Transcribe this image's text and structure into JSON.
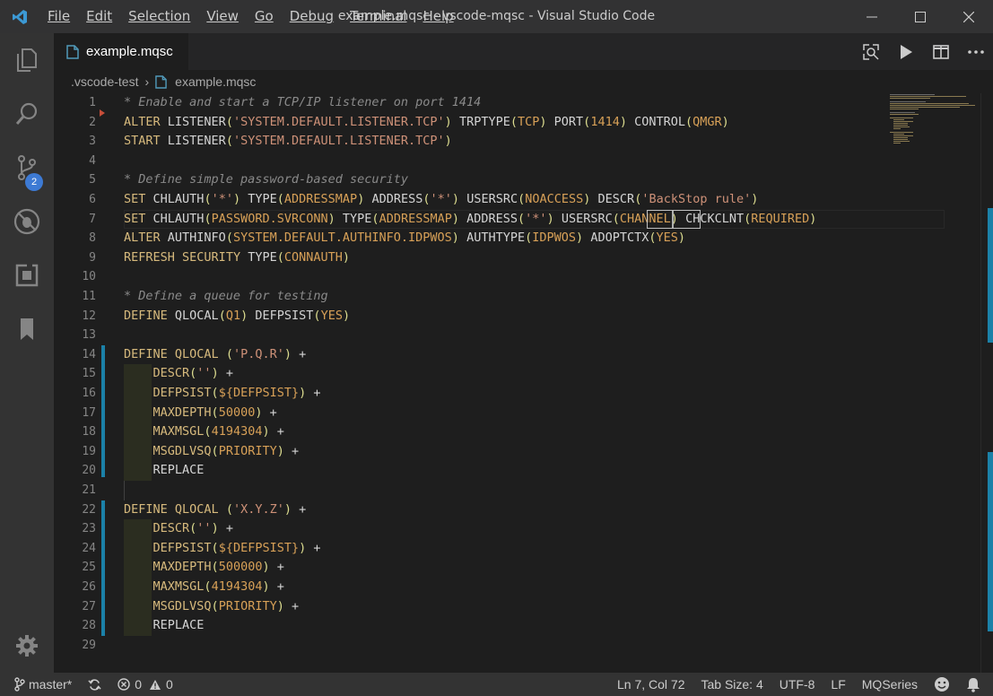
{
  "window": {
    "title": "example.mqsc - vscode-mqsc - Visual Studio Code"
  },
  "menu": {
    "items": [
      "File",
      "Edit",
      "Selection",
      "View",
      "Go",
      "Debug",
      "Terminal",
      "Help"
    ]
  },
  "activity_bar": {
    "items": [
      "explorer-icon",
      "search-icon",
      "source-control-icon",
      "debug-icon",
      "extensions-icon",
      "bookmarks-icon"
    ],
    "source_control_badge": "2",
    "settings_icon": "gear-icon"
  },
  "tab": {
    "label": "example.mqsc"
  },
  "breadcrumb": {
    "folder": ".vscode-test",
    "file": "example.mqsc"
  },
  "editor": {
    "line_numbers": [
      "1",
      "2",
      "3",
      "4",
      "5",
      "6",
      "7",
      "8",
      "9",
      "10",
      "11",
      "12",
      "13",
      "14",
      "15",
      "16",
      "17",
      "18",
      "19",
      "20",
      "21",
      "22",
      "23",
      "24",
      "25",
      "26",
      "27",
      "28",
      "29"
    ],
    "lines": [
      "* Enable and start a TCP/IP listener on port 1414",
      "ALTER LISTENER('SYSTEM.DEFAULT.LISTENER.TCP') TRPTYPE(TCP) PORT(1414) CONTROL(QMGR)",
      "START LISTENER('SYSTEM.DEFAULT.LISTENER.TCP')",
      "",
      "* Define simple password-based security",
      "SET CHLAUTH('*') TYPE(ADDRESSMAP) ADDRESS('*') USERSRC(NOACCESS) DESCR('BackStop rule')",
      "SET CHLAUTH(PASSWORD.SVRCONN) TYPE(ADDRESSMAP) ADDRESS('*') USERSRC(CHANNEL) CHCKCLNT(REQUIRED)",
      "ALTER AUTHINFO(SYSTEM.DEFAULT.AUTHINFO.IDPWOS) AUTHTYPE(IDPWOS) ADOPTCTX(YES)",
      "REFRESH SECURITY TYPE(CONNAUTH)",
      "",
      "* Define a queue for testing",
      "DEFINE QLOCAL(Q1) DEFPSIST(YES)",
      "",
      "DEFINE QLOCAL ('P.Q.R') +",
      "    DESCR('') +",
      "    DEFPSIST(${DEFPSIST}) +",
      "    MAXDEPTH(50000) +",
      "    MAXMSGL(4194304) +",
      "    MSGDLVSQ(PRIORITY) +",
      "    REPLACE",
      "",
      "DEFINE QLOCAL ('X.Y.Z') +",
      "    DESCR('') +",
      "    DEFPSIST(${DEFPSIST}) +",
      "    MAXDEPTH(500000) +",
      "    MAXMSGL(4194304) +",
      "    MSGDLVSQ(PRIORITY) +",
      "    REPLACE",
      ""
    ]
  },
  "status_bar": {
    "branch": "master*",
    "errors": "0",
    "warnings": "0",
    "position": "Ln 7, Col 72",
    "tab_size": "Tab Size: 4",
    "encoding": "UTF-8",
    "eol": "LF",
    "language": "MQSeries"
  },
  "colors": {
    "accent": "#1b81a8",
    "badge": "#3d7ad4",
    "statusbar": "#333333"
  }
}
